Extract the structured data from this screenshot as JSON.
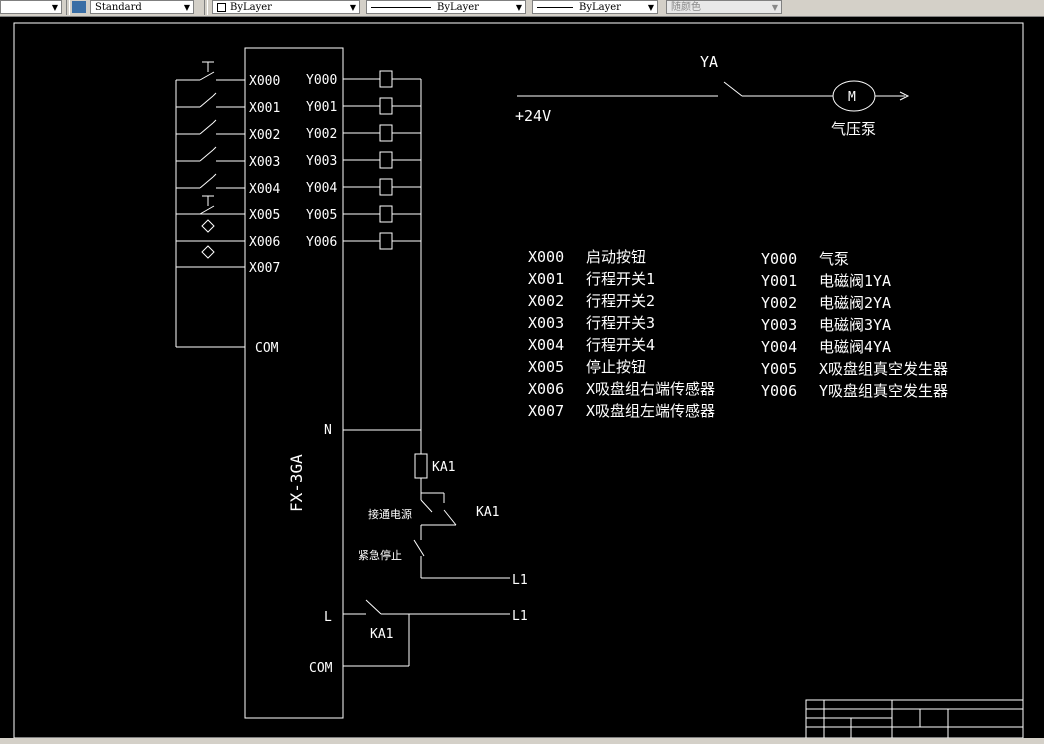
{
  "toolbar": {
    "text_style": "Standard",
    "layer": "ByLayer",
    "linetype": "ByLayer",
    "lineweight": "ByLayer",
    "color": "随颜色"
  },
  "plc": {
    "model": "FX-3GA",
    "inputs": [
      "X000",
      "X001",
      "X002",
      "X003",
      "X004",
      "X005",
      "X006",
      "X007"
    ],
    "outputs": [
      "Y000",
      "Y001",
      "Y002",
      "Y003",
      "Y004",
      "Y005",
      "Y006"
    ],
    "com_input": "COM",
    "n": "N",
    "l": "L",
    "com_power": "COM"
  },
  "pump": {
    "valve": "YA",
    "voltage": "+24V",
    "motor": "M",
    "label": "气压泵"
  },
  "relay": {
    "coil": "KA1",
    "contact": "KA1",
    "l_contact": "KA1",
    "start_label": "接通电源",
    "stop_label": "紧急停止",
    "l1_top": "L1",
    "l1_bottom": "L1"
  },
  "legend_inputs": [
    {
      "code": "X000",
      "desc": "启动按钮"
    },
    {
      "code": "X001",
      "desc": "行程开关1"
    },
    {
      "code": "X002",
      "desc": "行程开关2"
    },
    {
      "code": "X003",
      "desc": "行程开关3"
    },
    {
      "code": "X004",
      "desc": "行程开关4"
    },
    {
      "code": "X005",
      "desc": "停止按钮"
    },
    {
      "code": "X006",
      "desc": "X吸盘组右端传感器"
    },
    {
      "code": "X007",
      "desc": "X吸盘组左端传感器"
    }
  ],
  "legend_outputs": [
    {
      "code": "Y000",
      "desc": "气泵"
    },
    {
      "code": "Y001",
      "desc": "电磁阀1YA"
    },
    {
      "code": "Y002",
      "desc": "电磁阀2YA"
    },
    {
      "code": "Y003",
      "desc": "电磁阀3YA"
    },
    {
      "code": "Y004",
      "desc": "电磁阀4YA"
    },
    {
      "code": "Y005",
      "desc": "X吸盘组真空发生器"
    },
    {
      "code": "Y006",
      "desc": "Y吸盘组真空发生器"
    }
  ]
}
